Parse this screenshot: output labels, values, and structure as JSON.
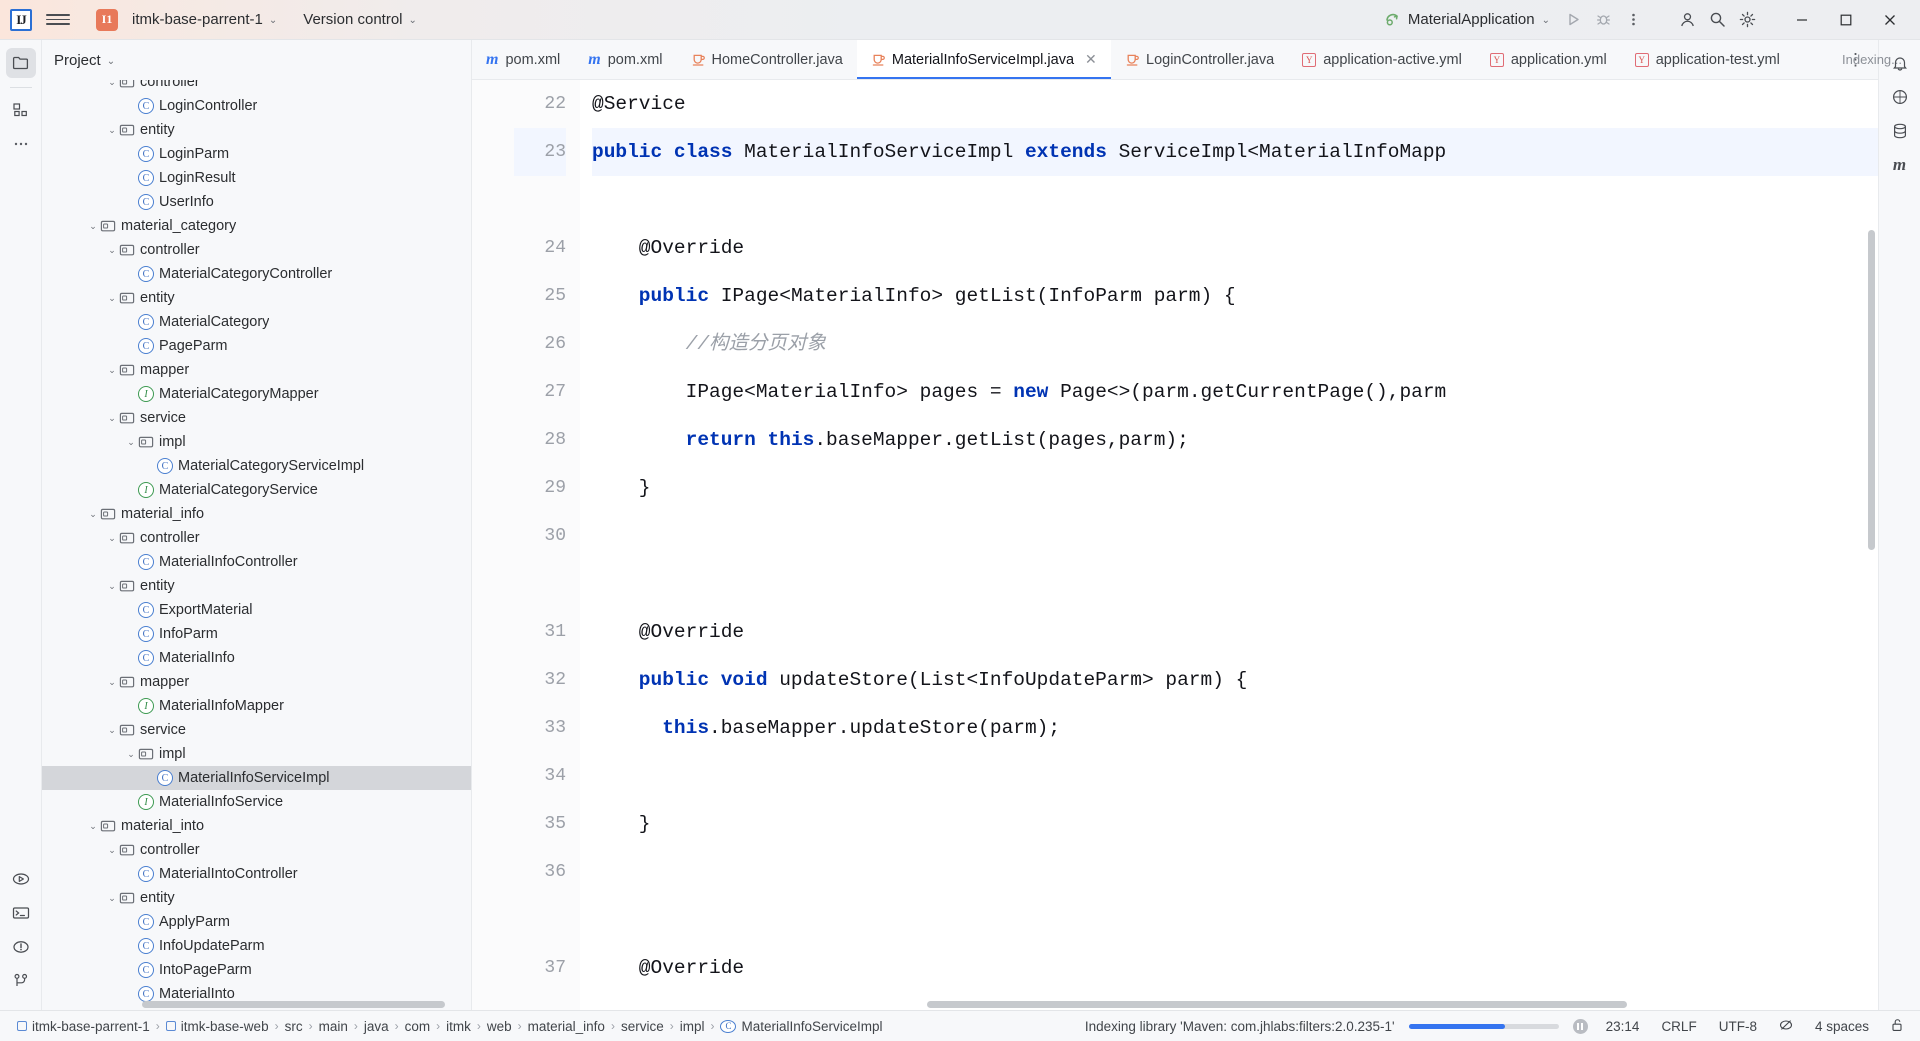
{
  "titlebar": {
    "logo": "IJ",
    "menu_icon": "hamburger-menu-icon",
    "project_badge": "I1",
    "project_name": "itmk-base-parrent-1",
    "vcs_label": "Version control",
    "run_config": "MaterialApplication",
    "run_icon": "run-icon",
    "debug_icon": "debug-icon",
    "more_icon": "more-options-icon",
    "account_icon": "account-icon",
    "search_icon": "search-icon",
    "settings_icon": "settings-gear-icon",
    "minimize": "minimize-icon",
    "maximize": "maximize-icon",
    "close": "close-icon"
  },
  "left_rail": {
    "top": [
      {
        "name": "project-tool-window",
        "icon": "folder-icon",
        "active": true
      },
      {
        "name": "structure-tool-window",
        "icon": "structure-icon",
        "active": false
      },
      {
        "name": "more-tool-windows",
        "icon": "ellipsis-icon",
        "active": false
      }
    ],
    "bottom": [
      {
        "name": "run-tool-window",
        "icon": "run-panel-icon"
      },
      {
        "name": "terminal-tool-window",
        "icon": "terminal-icon"
      },
      {
        "name": "problems-tool-window",
        "icon": "problems-icon"
      },
      {
        "name": "git-tool-window",
        "icon": "git-branch-icon"
      }
    ]
  },
  "right_rail": {
    "items": [
      {
        "name": "notifications",
        "icon": "bell-icon"
      },
      {
        "name": "ai-assistant",
        "icon": "ai-icon"
      },
      {
        "name": "database",
        "icon": "database-icon"
      },
      {
        "name": "maven",
        "icon": "maven-m-icon"
      }
    ]
  },
  "project_panel": {
    "header": "Project",
    "header_chevron": "chevron-down-icon",
    "tree": [
      {
        "depth": 3,
        "label": "controller",
        "kind": "folder",
        "expanded": true
      },
      {
        "depth": 4,
        "label": "LoginController",
        "kind": "class"
      },
      {
        "depth": 3,
        "label": "entity",
        "kind": "folder",
        "expanded": true
      },
      {
        "depth": 4,
        "label": "LoginParm",
        "kind": "class"
      },
      {
        "depth": 4,
        "label": "LoginResult",
        "kind": "class"
      },
      {
        "depth": 4,
        "label": "UserInfo",
        "kind": "class"
      },
      {
        "depth": 2,
        "label": "material_category",
        "kind": "folder",
        "expanded": true
      },
      {
        "depth": 3,
        "label": "controller",
        "kind": "folder",
        "expanded": true
      },
      {
        "depth": 4,
        "label": "MaterialCategoryController",
        "kind": "class"
      },
      {
        "depth": 3,
        "label": "entity",
        "kind": "folder",
        "expanded": true
      },
      {
        "depth": 4,
        "label": "MaterialCategory",
        "kind": "class"
      },
      {
        "depth": 4,
        "label": "PageParm",
        "kind": "class"
      },
      {
        "depth": 3,
        "label": "mapper",
        "kind": "folder",
        "expanded": true
      },
      {
        "depth": 4,
        "label": "MaterialCategoryMapper",
        "kind": "interface"
      },
      {
        "depth": 3,
        "label": "service",
        "kind": "folder",
        "expanded": true
      },
      {
        "depth": 4,
        "label": "impl",
        "kind": "folder",
        "expanded": true
      },
      {
        "depth": 5,
        "label": "MaterialCategoryServiceImpl",
        "kind": "class"
      },
      {
        "depth": 4,
        "label": "MaterialCategoryService",
        "kind": "interface"
      },
      {
        "depth": 2,
        "label": "material_info",
        "kind": "folder",
        "expanded": true
      },
      {
        "depth": 3,
        "label": "controller",
        "kind": "folder",
        "expanded": true
      },
      {
        "depth": 4,
        "label": "MaterialInfoController",
        "kind": "class"
      },
      {
        "depth": 3,
        "label": "entity",
        "kind": "folder",
        "expanded": true
      },
      {
        "depth": 4,
        "label": "ExportMaterial",
        "kind": "class"
      },
      {
        "depth": 4,
        "label": "InfoParm",
        "kind": "class"
      },
      {
        "depth": 4,
        "label": "MaterialInfo",
        "kind": "class"
      },
      {
        "depth": 3,
        "label": "mapper",
        "kind": "folder",
        "expanded": true
      },
      {
        "depth": 4,
        "label": "MaterialInfoMapper",
        "kind": "interface"
      },
      {
        "depth": 3,
        "label": "service",
        "kind": "folder",
        "expanded": true
      },
      {
        "depth": 4,
        "label": "impl",
        "kind": "folder",
        "expanded": true
      },
      {
        "depth": 5,
        "label": "MaterialInfoServiceImpl",
        "kind": "class",
        "selected": true
      },
      {
        "depth": 4,
        "label": "MaterialInfoService",
        "kind": "interface"
      },
      {
        "depth": 2,
        "label": "material_into",
        "kind": "folder",
        "expanded": true
      },
      {
        "depth": 3,
        "label": "controller",
        "kind": "folder",
        "expanded": true
      },
      {
        "depth": 4,
        "label": "MaterialIntoController",
        "kind": "class"
      },
      {
        "depth": 3,
        "label": "entity",
        "kind": "folder",
        "expanded": true
      },
      {
        "depth": 4,
        "label": "ApplyParm",
        "kind": "class"
      },
      {
        "depth": 4,
        "label": "InfoUpdateParm",
        "kind": "class"
      },
      {
        "depth": 4,
        "label": "IntoPageParm",
        "kind": "class"
      },
      {
        "depth": 4,
        "label": "MaterialInto",
        "kind": "class"
      }
    ]
  },
  "editor": {
    "tabs": [
      {
        "label": "pom.xml",
        "icon": "maven-m-icon",
        "active": false,
        "closable": false
      },
      {
        "label": "pom.xml",
        "icon": "maven-m-icon",
        "active": false,
        "closable": false
      },
      {
        "label": "HomeController.java",
        "icon": "java-class-icon",
        "active": false,
        "closable": false
      },
      {
        "label": "MaterialInfoServiceImpl.java",
        "icon": "java-class-icon",
        "active": true,
        "closable": true
      },
      {
        "label": "LoginController.java",
        "icon": "java-class-icon",
        "active": false,
        "closable": false
      },
      {
        "label": "application-active.yml",
        "icon": "yaml-icon",
        "active": false,
        "closable": false
      },
      {
        "label": "application.yml",
        "icon": "yaml-icon",
        "active": false,
        "closable": false
      },
      {
        "label": "application-test.yml",
        "icon": "yaml-icon",
        "active": false,
        "closable": false
      }
    ],
    "tabs_more_icon": "tab-overflow-icon",
    "close_icon": "close-tab-icon",
    "indexing_note": "Indexing...",
    "lines": [
      {
        "n": "22",
        "highlight": false,
        "tokens": [
          {
            "t": "@Service",
            "c": "plain"
          }
        ]
      },
      {
        "n": "23",
        "highlight": true,
        "tokens": [
          {
            "t": "public class ",
            "c": "kw"
          },
          {
            "t": "MaterialInfoServiceImpl ",
            "c": "plain"
          },
          {
            "t": "extends ",
            "c": "kw"
          },
          {
            "t": "ServiceImpl<MaterialInfoMapp",
            "c": "plain"
          }
        ]
      },
      {
        "n": "",
        "highlight": false,
        "tokens": []
      },
      {
        "n": "24",
        "highlight": false,
        "tokens": [
          {
            "t": "    @Override",
            "c": "plain"
          }
        ]
      },
      {
        "n": "25",
        "highlight": false,
        "tokens": [
          {
            "t": "    public ",
            "c": "kw"
          },
          {
            "t": "IPage<MaterialInfo> getList(InfoParm parm) {",
            "c": "plain"
          }
        ]
      },
      {
        "n": "26",
        "highlight": false,
        "tokens": [
          {
            "t": "        //构造分页对象",
            "c": "cmt"
          }
        ]
      },
      {
        "n": "27",
        "highlight": false,
        "tokens": [
          {
            "t": "        IPage<MaterialInfo> pages = ",
            "c": "plain"
          },
          {
            "t": "new ",
            "c": "kw"
          },
          {
            "t": "Page<>(parm.getCurrentPage(),parm",
            "c": "plain"
          }
        ]
      },
      {
        "n": "28",
        "highlight": false,
        "tokens": [
          {
            "t": "        ",
            "c": "plain"
          },
          {
            "t": "return this",
            "c": "kw"
          },
          {
            "t": ".baseMapper.getList(pages,parm);",
            "c": "plain"
          }
        ]
      },
      {
        "n": "29",
        "highlight": false,
        "tokens": [
          {
            "t": "    }",
            "c": "plain"
          }
        ]
      },
      {
        "n": "30",
        "highlight": false,
        "tokens": []
      },
      {
        "n": "",
        "highlight": false,
        "tokens": []
      },
      {
        "n": "31",
        "highlight": false,
        "tokens": [
          {
            "t": "    @Override",
            "c": "plain"
          }
        ]
      },
      {
        "n": "32",
        "highlight": false,
        "tokens": [
          {
            "t": "    public void ",
            "c": "kw"
          },
          {
            "t": "updateStore(List<InfoUpdateParm> parm) {",
            "c": "plain"
          }
        ]
      },
      {
        "n": "33",
        "highlight": false,
        "tokens": [
          {
            "t": "      ",
            "c": "plain"
          },
          {
            "t": "this",
            "c": "kw"
          },
          {
            "t": ".baseMapper.updateStore(parm);",
            "c": "plain"
          }
        ]
      },
      {
        "n": "34",
        "highlight": false,
        "tokens": []
      },
      {
        "n": "35",
        "highlight": false,
        "tokens": [
          {
            "t": "    }",
            "c": "plain"
          }
        ]
      },
      {
        "n": "36",
        "highlight": false,
        "tokens": []
      },
      {
        "n": "",
        "highlight": false,
        "tokens": []
      },
      {
        "n": "37",
        "highlight": false,
        "tokens": [
          {
            "t": "    @Override",
            "c": "plain"
          }
        ]
      }
    ]
  },
  "status_bar": {
    "breadcrumbs": [
      {
        "label": "itmk-base-parrent-1",
        "icon": "module-icon"
      },
      {
        "label": "itmk-base-web",
        "icon": "module-icon"
      },
      {
        "label": "src",
        "icon": ""
      },
      {
        "label": "main",
        "icon": ""
      },
      {
        "label": "java",
        "icon": ""
      },
      {
        "label": "com",
        "icon": ""
      },
      {
        "label": "itmk",
        "icon": ""
      },
      {
        "label": "web",
        "icon": ""
      },
      {
        "label": "material_info",
        "icon": ""
      },
      {
        "label": "service",
        "icon": ""
      },
      {
        "label": "impl",
        "icon": ""
      },
      {
        "label": "MaterialInfoServiceImpl",
        "icon": "class-icon"
      }
    ],
    "separator": "›",
    "indexing_text": "Indexing library 'Maven: com.jhlabs:filters:2.0.235-1'",
    "progress_percent": 64,
    "pause_icon": "pause-icon",
    "caret_position": "23:14",
    "line_separator": "CRLF",
    "encoding": "UTF-8",
    "read_only_icon": "no-access-icon",
    "indent": "4 spaces",
    "lock_icon": "unlocked-icon"
  },
  "colors": {
    "accent": "#3574f0",
    "keyword": "#0033b3",
    "comment": "#9ba0a8",
    "selection": "#d4d6da",
    "highlight_line": "#f2f6ff",
    "panel_bg": "#f7f8fa",
    "editor_bg": "#ffffff",
    "project_badge": "#e8795a"
  }
}
